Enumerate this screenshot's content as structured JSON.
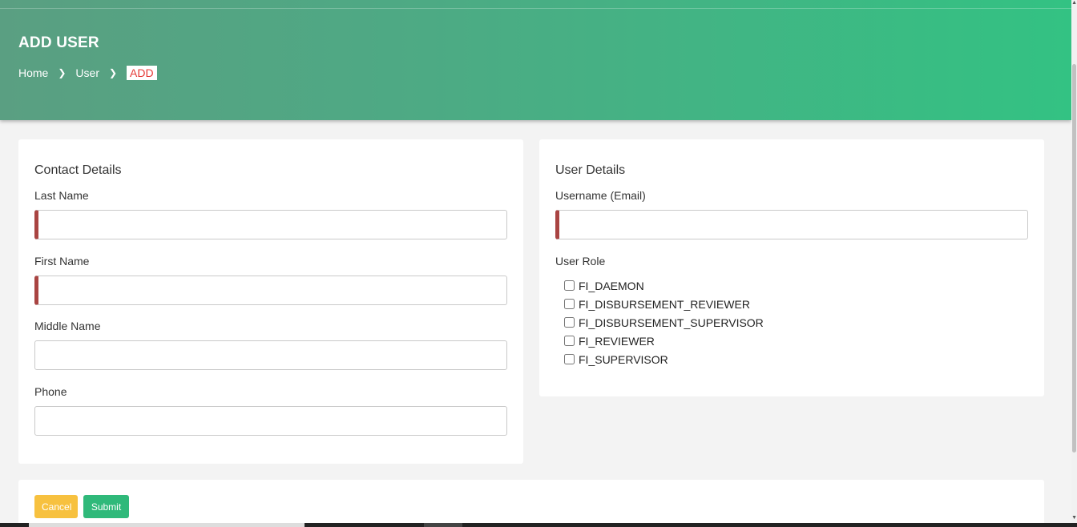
{
  "header": {
    "title": "ADD USER",
    "breadcrumb": [
      "Home",
      "User",
      "ADD"
    ]
  },
  "contact": {
    "title": "Contact Details",
    "last_name_label": "Last Name",
    "last_name_value": "",
    "first_name_label": "First Name",
    "first_name_value": "",
    "middle_name_label": "Middle Name",
    "middle_name_value": "",
    "phone_label": "Phone",
    "phone_value": ""
  },
  "user": {
    "title": "User Details",
    "username_label": "Username (Email)",
    "username_value": "",
    "role_label": "User Role",
    "roles": [
      {
        "label": "FI_DAEMON",
        "checked": false
      },
      {
        "label": "FI_DISBURSEMENT_REVIEWER",
        "checked": false
      },
      {
        "label": "FI_DISBURSEMENT_SUPERVISOR",
        "checked": false
      },
      {
        "label": "FI_REVIEWER",
        "checked": false
      },
      {
        "label": "FI_SUPERVISOR",
        "checked": false
      }
    ]
  },
  "actions": {
    "cancel_label": "Cancel",
    "submit_label": "Submit"
  },
  "colors": {
    "header_start": "#5a9f82",
    "header_end": "#33c283",
    "required_marker": "#a94442",
    "cancel": "#f7c13f",
    "submit": "#2fb97a",
    "active_crumb": "#e53935"
  }
}
